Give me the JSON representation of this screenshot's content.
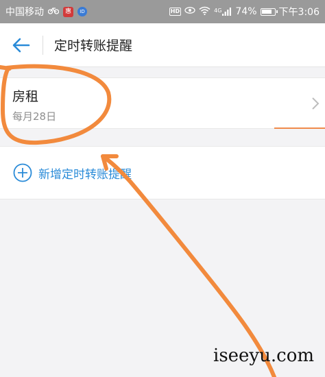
{
  "status_bar": {
    "carrier": "中国移动",
    "signal_type": "4G",
    "battery_percent": "74%",
    "time": "下午3:06",
    "hd_label": "HD"
  },
  "nav": {
    "title": "定时转账提醒"
  },
  "reminders": [
    {
      "name": "房租",
      "schedule": "每月28日"
    }
  ],
  "add_action": {
    "label": "新增定时转账提醒"
  },
  "watermark": "iseeyu.com",
  "colors": {
    "status_bar_bg": "#9a9a9a",
    "accent_blue": "#2a8bd8",
    "annotation_orange": "#f28a3d",
    "page_bg": "#f3f3f5"
  }
}
